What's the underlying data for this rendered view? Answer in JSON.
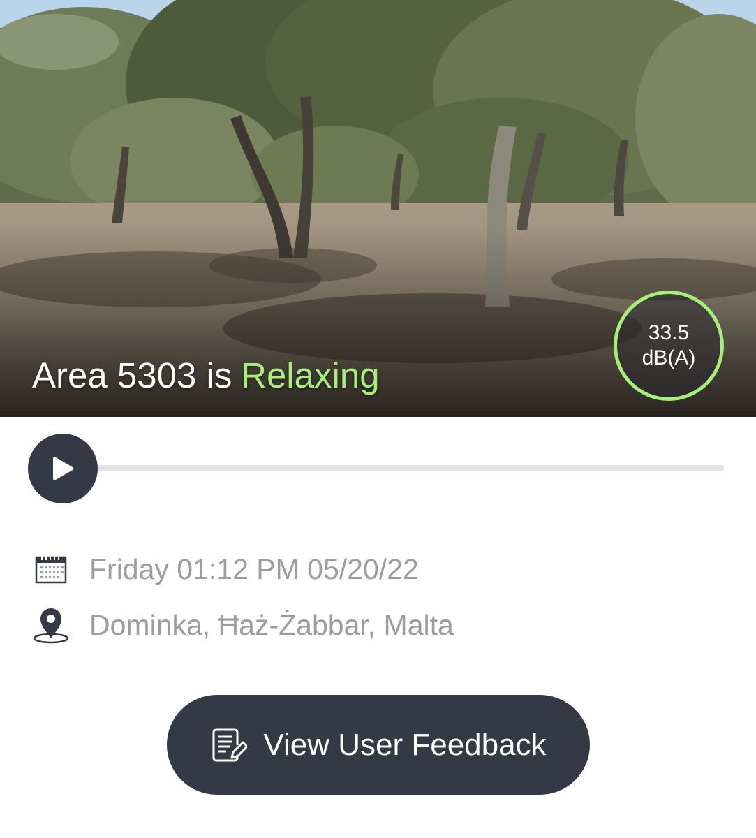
{
  "hero": {
    "title_prefix": "Area 5303 is",
    "status": "Relaxing",
    "status_color": "#a6f07a",
    "image_icon": "forest-photo",
    "level_value": "33.5",
    "level_unit": "dB(A)",
    "level_ring_color": "#a6f07a"
  },
  "player": {
    "play_icon": "play-icon",
    "progress": 0
  },
  "details": {
    "date_icon": "calendar-icon",
    "date_text": "Friday 01:12 PM 05/20/22",
    "location_icon": "location-pin-icon",
    "location_text": "Dominka, Ħaż-Żabbar, Malta"
  },
  "actions": {
    "feedback_icon": "document-edit-icon",
    "feedback_label": "View User Feedback"
  },
  "colors": {
    "dark": "#353946",
    "muted_text": "#9b9ba0",
    "track": "#e3e3e6"
  }
}
